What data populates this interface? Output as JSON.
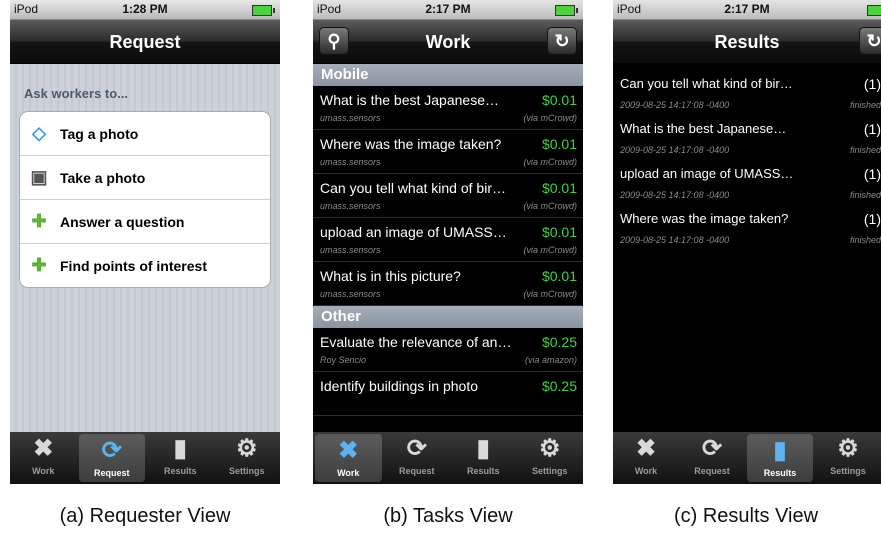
{
  "status": {
    "carrier": "iPod",
    "time_a": "1:28 PM",
    "time_b": "2:17 PM",
    "time_c": "2:17 PM"
  },
  "tabs": [
    {
      "label": "Work",
      "icon": "wrench-icon"
    },
    {
      "label": "Request",
      "icon": "arrows-icon"
    },
    {
      "label": "Results",
      "icon": "clipboard-icon"
    },
    {
      "label": "Settings",
      "icon": "gear-icon"
    }
  ],
  "request_view": {
    "title": "Request",
    "heading": "Ask workers to...",
    "items": [
      {
        "label": "Tag a photo",
        "icon": "tag-icon"
      },
      {
        "label": "Take a photo",
        "icon": "camera-icon"
      },
      {
        "label": "Answer a question",
        "icon": "puzzle-icon"
      },
      {
        "label": "Find points of interest",
        "icon": "puzzle-icon"
      }
    ],
    "caption": "(a) Requester View"
  },
  "work_view": {
    "title": "Work",
    "sections": [
      {
        "name": "Mobile",
        "tasks": [
          {
            "title": "What is the best Japanese…",
            "price": "$0.01",
            "owner": "umass.sensors",
            "via": "(via mCrowd)"
          },
          {
            "title": "Where was the image taken?",
            "price": "$0.01",
            "owner": "umass.sensors",
            "via": "(via mCrowd)"
          },
          {
            "title": "Can you tell what kind of bir…",
            "price": "$0.01",
            "owner": "umass.sensors",
            "via": "(via mCrowd)"
          },
          {
            "title": "upload an image of UMASS…",
            "price": "$0.01",
            "owner": "umass.sensors",
            "via": "(via mCrowd)"
          },
          {
            "title": "What is in this picture?",
            "price": "$0.01",
            "owner": "umass.sensors",
            "via": "(via mCrowd)"
          }
        ]
      },
      {
        "name": "Other",
        "tasks": [
          {
            "title": "Evaluate the relevance of an…",
            "price": "$0.25",
            "owner": "Roy Sencio",
            "via": "(via amazon)"
          },
          {
            "title": "Identify buildings in photo",
            "price": "$0.25",
            "owner": "",
            "via": ""
          }
        ]
      }
    ],
    "caption": "(b) Tasks View"
  },
  "results_view": {
    "title": "Results",
    "items": [
      {
        "title": "Can you tell what kind of bir…",
        "count": "(1)",
        "date": "2009-08-25 14:17:08 -0400",
        "status": "finished"
      },
      {
        "title": "What is the best Japanese…",
        "count": "(1)",
        "date": "2009-08-25 14:17:08 -0400",
        "status": "finished"
      },
      {
        "title": "upload an image of UMASS…",
        "count": "(1)",
        "date": "2009-08-25 14:17:08 -0400",
        "status": "finished"
      },
      {
        "title": "Where was the image taken?",
        "count": "(1)",
        "date": "2009-08-25 14:17:08 -0400",
        "status": "finished"
      }
    ],
    "caption": "(c) Results View"
  },
  "colors": {
    "price_green": "#3ad53a",
    "active_tab_blue": "#5bb3f0",
    "battery_green": "#4cd23b"
  }
}
